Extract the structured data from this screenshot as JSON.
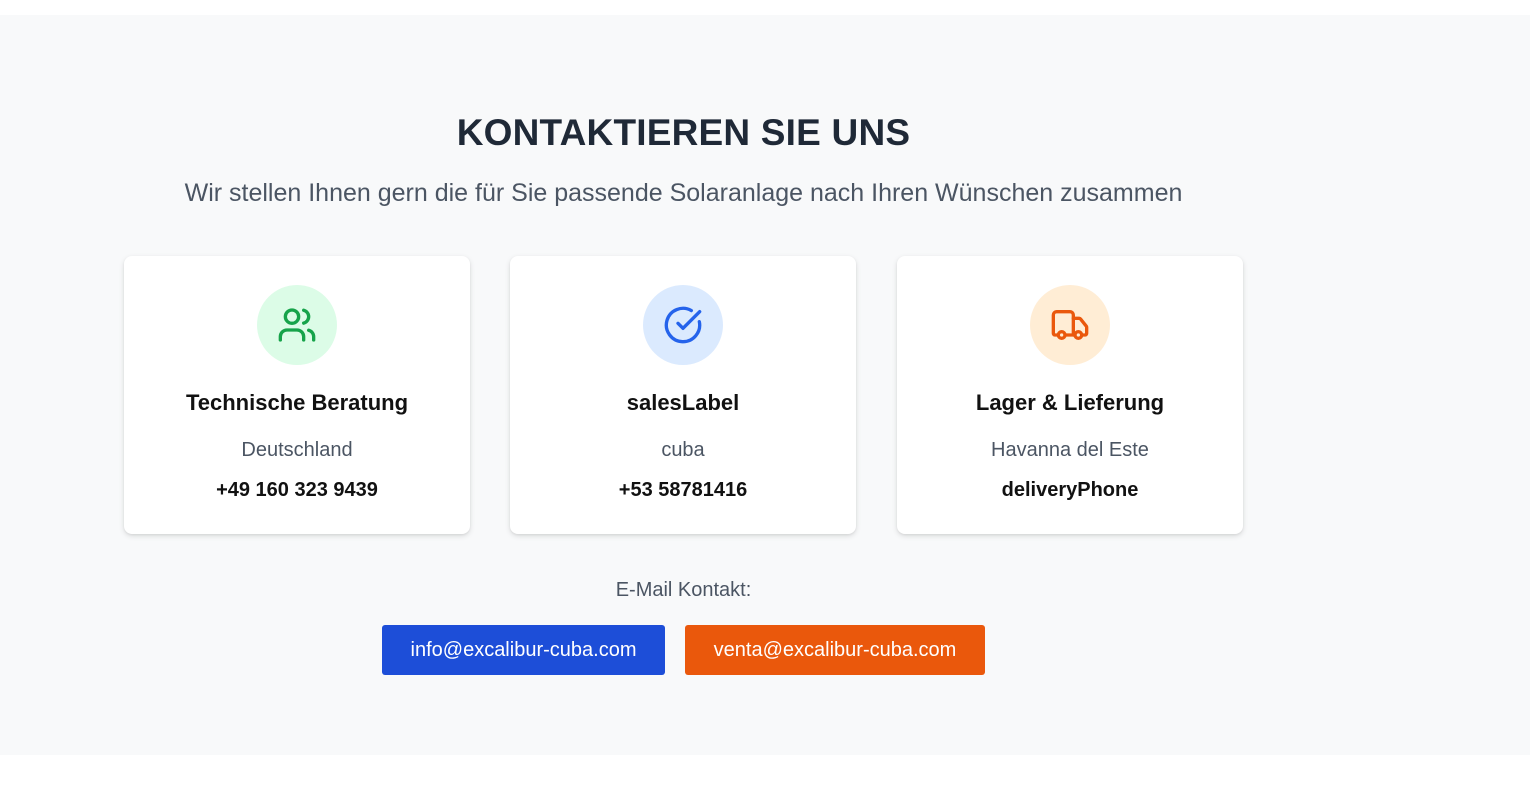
{
  "contact": {
    "heading": "KONTAKTIEREN SIE UNS",
    "subtitle": "Wir stellen Ihnen gern die für Sie passende Solaranlage nach Ihren Wünschen zusammen",
    "cards": [
      {
        "icon": "users-icon",
        "icon_color": "#16a34a",
        "icon_bg": "#dcfce7",
        "title": "Technische Beratung",
        "location": "Deutschland",
        "phone": "+49 160 323 9439"
      },
      {
        "icon": "check-circle-icon",
        "icon_color": "#2563eb",
        "icon_bg": "#dbeafe",
        "title": "salesLabel",
        "location": "cuba",
        "phone": "+53 58781416"
      },
      {
        "icon": "truck-icon",
        "icon_color": "#ea580c",
        "icon_bg": "#ffedd5",
        "title": "Lager & Lieferung",
        "location": "Havanna del Este",
        "phone": "deliveryPhone"
      }
    ],
    "email_label": "E-Mail Kontakt:",
    "emails": [
      {
        "address": "info@excalibur-cuba.com",
        "color": "#1d4ed8"
      },
      {
        "address": "venta@excalibur-cuba.com",
        "color": "#ea580c"
      }
    ]
  }
}
